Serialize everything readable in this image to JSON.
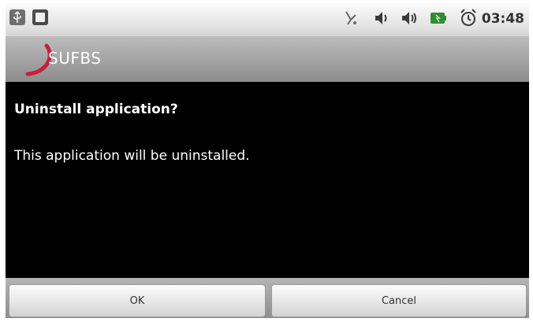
{
  "status_bar": {
    "time": "03:48",
    "icons": [
      "usb-icon",
      "sd-card-icon",
      "mic-icon",
      "volume-icon",
      "volume-icon-2",
      "battery-icon",
      "alarm-icon"
    ]
  },
  "title_bar": {
    "app_name": "SUFBS"
  },
  "dialog": {
    "title": "Uninstall application?",
    "message": "This application will be uninstalled.",
    "ok_label": "OK",
    "cancel_label": "Cancel"
  },
  "colors": {
    "background": "#000000",
    "status_bar": "#e6e6e6",
    "title_bar": "#a5a5a5",
    "battery": "#2f8f2f",
    "logo_arc": "#c8203c"
  }
}
